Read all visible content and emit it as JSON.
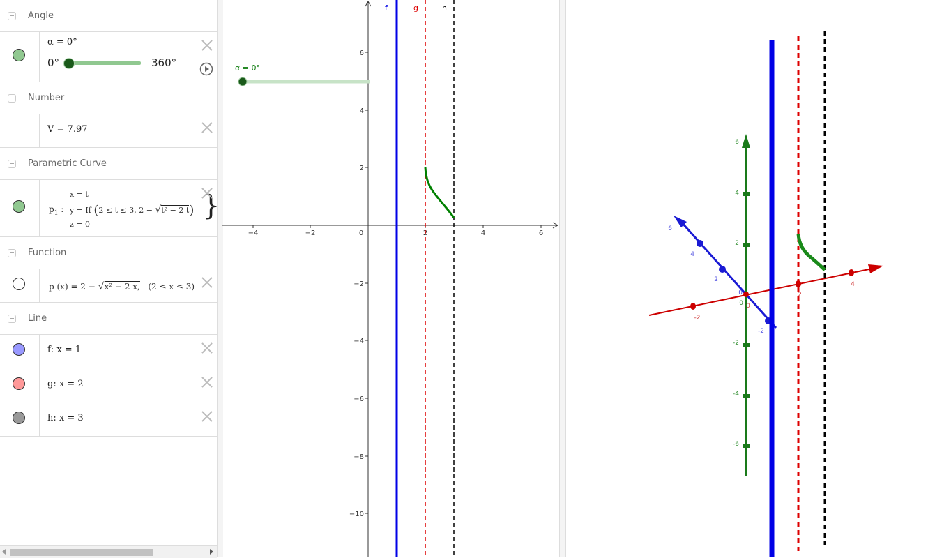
{
  "algebra": {
    "sections": [
      {
        "title": "Angle"
      },
      {
        "title": "Number"
      },
      {
        "title": "Parametric Curve"
      },
      {
        "title": "Function"
      },
      {
        "title": "Line"
      }
    ],
    "angle": {
      "definition": "α = 0°",
      "slider_min": "0°",
      "slider_max": "360°",
      "value": 0,
      "min": 0,
      "max": 360,
      "color": "#90c890"
    },
    "number": {
      "definition": "V = 7.97"
    },
    "curve": {
      "name": "p",
      "sub": "1",
      "colon": ":",
      "x_line": "x = t",
      "y_if": "y = If",
      "y_cond": "2 ≤ t ≤ 3, 2 −",
      "y_rad": "t² − 2 t",
      "z_line": "z = 0",
      "color": "#90c890"
    },
    "function": {
      "head": "p (x)  =  2 −",
      "rad": "x² − 2 x,",
      "cond": "(2 ≤ x ≤ 3)",
      "color": "#ffffff"
    },
    "lines": [
      {
        "definition": "f: x = 1",
        "color": "#9999ff"
      },
      {
        "definition": "g: x = 2",
        "color": "#ff9999"
      },
      {
        "definition": "h: x = 3",
        "color": "#999999"
      }
    ]
  },
  "graphics2d": {
    "slider_label": "α = 0°",
    "line_labels": [
      "f",
      "g",
      "h"
    ],
    "x_ticks": [
      "−4",
      "−2",
      "0",
      "2",
      "4",
      "6"
    ],
    "y_ticks": [
      "6",
      "4",
      "2",
      "−2",
      "−4",
      "−6",
      "−8",
      "−10"
    ],
    "colors": {
      "f": "#0000e6",
      "g": "#dd0000",
      "h": "#000000",
      "curve": "#008000"
    }
  },
  "graphics3d": {
    "x_ticks": [
      "-2",
      "0",
      "2",
      "4"
    ],
    "y_ticks": [
      "6",
      "4",
      "2",
      "0",
      "-2"
    ],
    "z_ticks": [
      "6",
      "4",
      "2",
      "0",
      "-2",
      "-4",
      "-6"
    ],
    "colors": {
      "x": "#cc0000",
      "y": "#1a1ad4",
      "z": "#1a7a1a"
    }
  }
}
